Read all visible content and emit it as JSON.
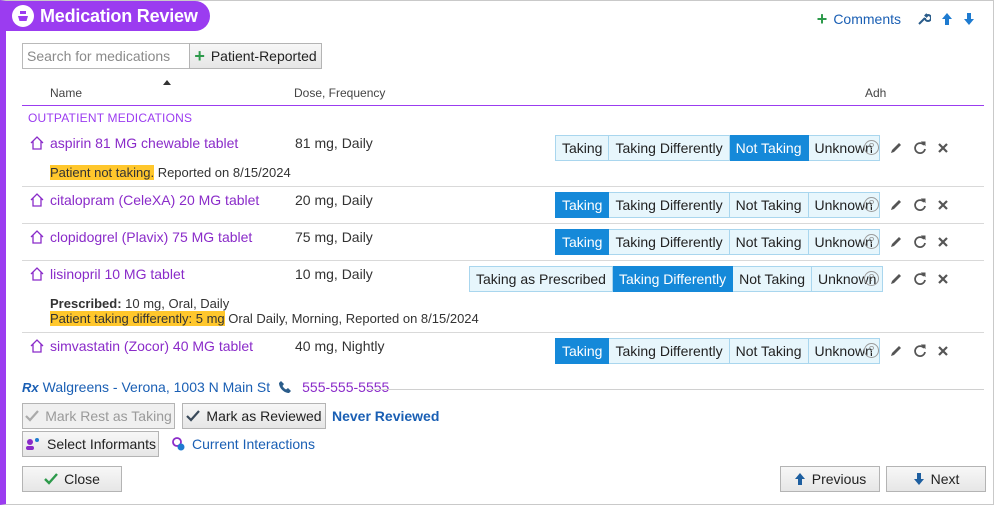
{
  "header": {
    "title": "Medication Review",
    "comments_label": "Comments"
  },
  "search": {
    "placeholder": "Search for medications"
  },
  "patient_reported_label": "Patient-Reported",
  "columns": {
    "name": "Name",
    "dose": "Dose, Frequency",
    "adh": "Adh"
  },
  "section_label": "OUTPATIENT MEDICATIONS",
  "meds": [
    {
      "name": "aspirin 81 MG chewable tablet",
      "dose": "81 mg, Daily",
      "options": [
        "Taking",
        "Taking Differently",
        "Not Taking",
        "Unknown"
      ],
      "selected": "Not Taking",
      "note_highlight": "Patient not taking.",
      "note_rest": " Reported on 8/15/2024"
    },
    {
      "name": "citalopram (CeleXA) 20 MG tablet",
      "dose": "20 mg, Daily",
      "options": [
        "Taking",
        "Taking Differently",
        "Not Taking",
        "Unknown"
      ],
      "selected": "Taking"
    },
    {
      "name": "clopidogrel (Plavix) 75 MG tablet",
      "dose": "75 mg, Daily",
      "options": [
        "Taking",
        "Taking Differently",
        "Not Taking",
        "Unknown"
      ],
      "selected": "Taking"
    },
    {
      "name": "lisinopril 10 MG tablet",
      "dose": "10 mg, Daily",
      "options": [
        "Taking as Prescribed",
        "Taking Differently",
        "Not Taking",
        "Unknown"
      ],
      "selected": "Taking Differently",
      "prescribed_label": "Prescribed:",
      "prescribed_value": " 10 mg, Oral, Daily",
      "note_highlight": "Patient taking differently: 5 mg",
      "note_rest": " Oral Daily, Morning, Reported on 8/15/2024"
    },
    {
      "name": "simvastatin (Zocor) 40 MG tablet",
      "dose": "40 mg, Nightly",
      "options": [
        "Taking",
        "Taking Differently",
        "Not Taking",
        "Unknown"
      ],
      "selected": "Taking"
    }
  ],
  "pharmacy": {
    "rx": "Rx",
    "name": "Walgreens - Verona, 1003 N Main St",
    "phone": "555-555-5555"
  },
  "buttons": {
    "mark_rest": "Mark Rest as Taking",
    "mark_reviewed": "Mark as Reviewed",
    "select_informants": "Select Informants",
    "close": "Close",
    "previous": "Previous",
    "next": "Next"
  },
  "review_status": "Never Reviewed",
  "current_interactions": "Current Interactions",
  "colors": {
    "accent": "#9b3cf0",
    "selected": "#1589d9",
    "link": "#1a5fb4",
    "highlight": "#ffc72c"
  }
}
